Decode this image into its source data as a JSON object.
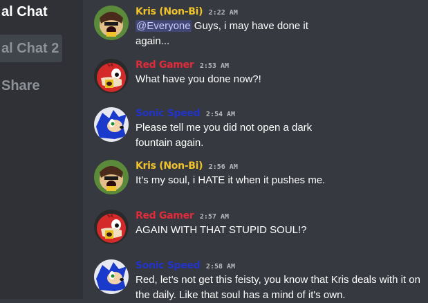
{
  "sidebar": {
    "channels": [
      {
        "label": "al Chat"
      },
      {
        "label": "al Chat 2"
      },
      {
        "label": "Share"
      }
    ]
  },
  "messages": [
    {
      "author": "Kris (Non-Bi)",
      "time": "2:22 AM",
      "color": "#f0c22b",
      "avatar": "kris-avatar",
      "mention": "@Everyone",
      "text": "Guys, i may have done it again..."
    },
    {
      "author": "Red Gamer",
      "time": "2:53 AM",
      "color": "#e12b3a",
      "avatar": "red-avatar",
      "text": "What have you done now?!"
    },
    {
      "author": "Sonic Speed",
      "time": "2:54 AM",
      "color": "#2233cc",
      "avatar": "sonic-avatar",
      "text": "Please tell me you did not open a dark fountain again."
    },
    {
      "author": "Kris (Non-Bi)",
      "time": "2:56 AM",
      "color": "#f0c22b",
      "avatar": "kris-avatar",
      "text": "It's my soul, i HATE it when it pushes me."
    },
    {
      "author": "Red Gamer",
      "time": "2:57 AM",
      "color": "#e12b3a",
      "avatar": "red-avatar",
      "text": "AGAIN WITH THAT STUPID SOUL!?"
    },
    {
      "author": "Sonic Speed",
      "time": "2:58 AM",
      "color": "#2233cc",
      "avatar": "sonic-avatar",
      "text": "Red, let's not get this feisty, you know that Kris deals with it on the daily. Like that soul has a mind of it's own."
    }
  ]
}
